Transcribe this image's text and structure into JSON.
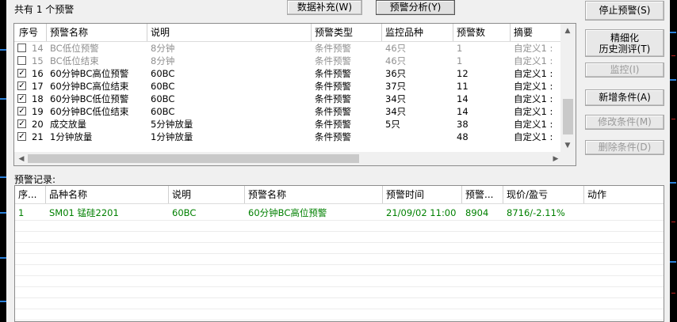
{
  "summary": "共有 1 个预警",
  "top_buttons": {
    "supplement": "数据补充(W)",
    "analysis": "预警分析(Y)"
  },
  "side_buttons": {
    "stop": "停止预警(S)",
    "refine_line1": "精细化",
    "refine_line2": "历史测评(T)",
    "monitor": "监控(I)",
    "add": "新增条件(A)",
    "modify": "修改条件(M)",
    "delete": "删除条件(D)"
  },
  "conditions": {
    "headers": [
      "序号",
      "预警名称",
      "说明",
      "预警类型",
      "监控品种",
      "预警数",
      "摘要"
    ],
    "rows": [
      {
        "checked": false,
        "dim": true,
        "no": "14",
        "name": "BC低位预警",
        "desc": "8分钟",
        "type": "条件预警",
        "watch": "46只",
        "count": "1",
        "summary": "自定义1 :"
      },
      {
        "checked": false,
        "dim": true,
        "no": "15",
        "name": "BC低位结束",
        "desc": "8分钟",
        "type": "条件预警",
        "watch": "46只",
        "count": "1",
        "summary": "自定义1 :"
      },
      {
        "checked": true,
        "dim": false,
        "no": "16",
        "name": "60分钟BC高位预警",
        "desc": "60BC",
        "type": "条件预警",
        "watch": "36只",
        "count": "12",
        "summary": "自定义1 :"
      },
      {
        "checked": true,
        "dim": false,
        "no": "17",
        "name": "60分钟BC高位结束",
        "desc": "60BC",
        "type": "条件预警",
        "watch": "37只",
        "count": "11",
        "summary": "自定义1 :"
      },
      {
        "checked": true,
        "dim": false,
        "no": "18",
        "name": "60分钟BC低位预警",
        "desc": "60BC",
        "type": "条件预警",
        "watch": "34只",
        "count": "14",
        "summary": "自定义1 :"
      },
      {
        "checked": true,
        "dim": false,
        "no": "19",
        "name": "60分钟BC低位结束",
        "desc": "60BC",
        "type": "条件预警",
        "watch": "34只",
        "count": "14",
        "summary": "自定义1 :"
      },
      {
        "checked": true,
        "dim": false,
        "no": "20",
        "name": "成交放量",
        "desc": "5分钟放量",
        "type": "条件预警",
        "watch": "5只",
        "count": "38",
        "summary": "自定义1 :"
      },
      {
        "checked": true,
        "dim": false,
        "no": "21",
        "name": "1分钟放量",
        "desc": "1分钟放量",
        "type": "条件预警",
        "watch": "",
        "count": "48",
        "summary": "自定义1 :"
      }
    ]
  },
  "records_label": "预警记录:",
  "records": {
    "headers": [
      "序...",
      "品种名称",
      "说明",
      "预警名称",
      "预警时间",
      "预警...",
      "现价/盈亏",
      "动作"
    ],
    "rows": [
      {
        "no": "1",
        "product": "SM01 锰硅2201",
        "desc": "60BC",
        "alert": "60分钟BC高位预警",
        "time": "21/09/02 11:00",
        "price": "8904",
        "pnl": "8716/-2.11%",
        "action": ""
      }
    ]
  },
  "colors": {
    "record_text": "#008000",
    "dim_text": "#909090",
    "bg": "#f0f0f0"
  }
}
